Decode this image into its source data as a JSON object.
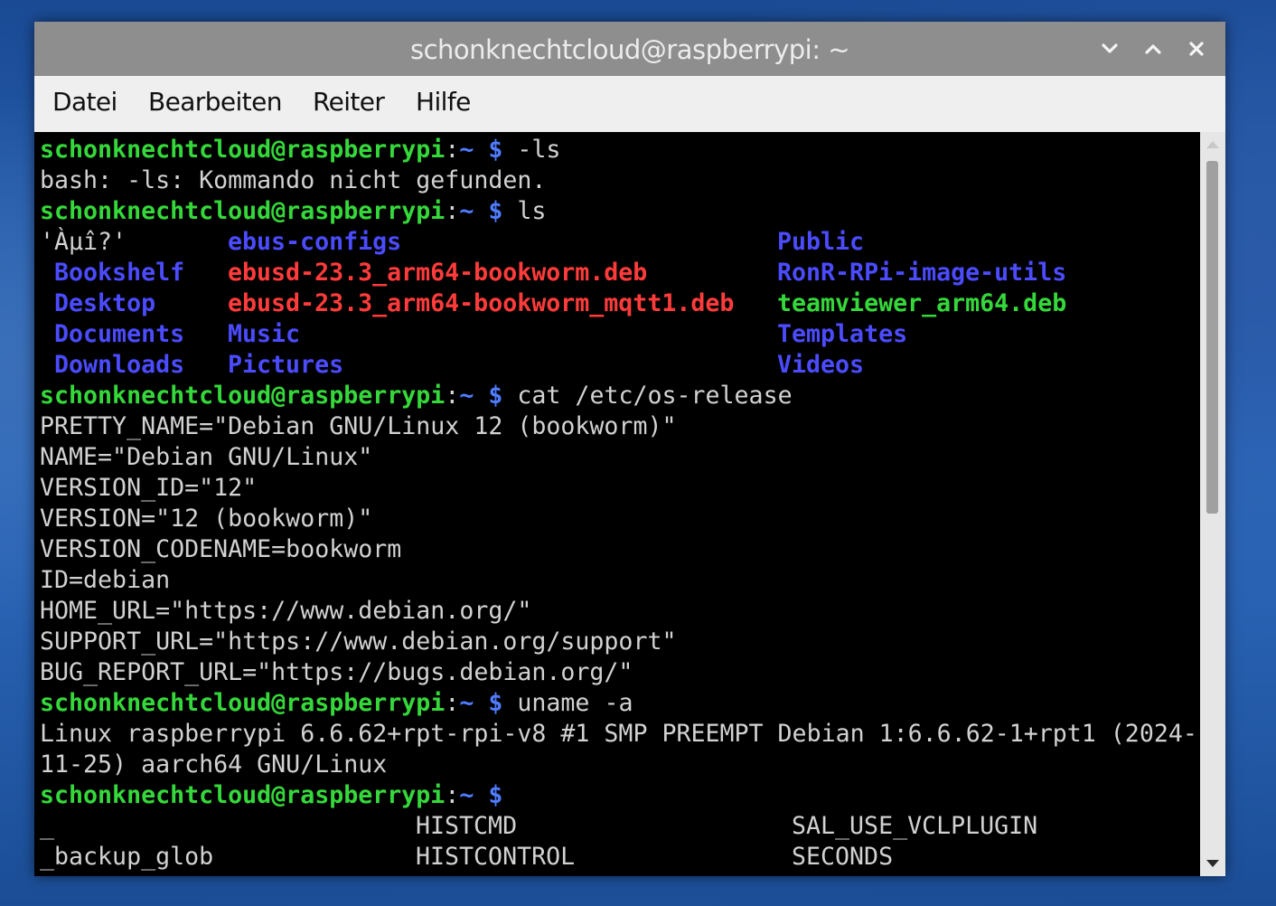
{
  "window": {
    "title": "schonknechtcloud@raspberrypi: ~",
    "buttons": [
      "minimize",
      "maximize",
      "close"
    ]
  },
  "menu": [
    "Datei",
    "Bearbeiten",
    "Reiter",
    "Hilfe"
  ],
  "prompt": {
    "user_host": "schonknechtcloud@raspberrypi",
    "colon": ":",
    "path": "~ $"
  },
  "terminal": {
    "cmd1": " -ls",
    "out1": "bash: -ls: Kommando nicht gefunden.",
    "cmd2": " ls",
    "ls_listing": {
      "col1": [
        "'Àµî?'",
        " Bookshelf",
        " Desktop",
        " Documents",
        " Downloads"
      ],
      "col2": [
        "ebus-configs",
        "ebusd-23.3_arm64-bookworm.deb",
        "ebusd-23.3_arm64-bookworm_mqtt1.deb",
        "Music",
        "Pictures"
      ],
      "col3": [
        "Public",
        "RonR-RPi-image-utils",
        "teamviewer_arm64.deb",
        "Templates",
        "Videos"
      ],
      "kinds": {
        "col1": [
          "plain",
          "dir",
          "dir",
          "dir",
          "dir"
        ],
        "col2": [
          "dir",
          "deb",
          "deb",
          "dir",
          "dir"
        ],
        "col3": [
          "dir",
          "dir",
          "exe",
          "dir",
          "dir"
        ]
      }
    },
    "cmd3": " cat /etc/os-release",
    "os_release": [
      "PRETTY_NAME=\"Debian GNU/Linux 12 (bookworm)\"",
      "NAME=\"Debian GNU/Linux\"",
      "VERSION_ID=\"12\"",
      "VERSION=\"12 (bookworm)\"",
      "VERSION_CODENAME=bookworm",
      "ID=debian",
      "HOME_URL=\"https://www.debian.org/\"",
      "SUPPORT_URL=\"https://www.debian.org/support\"",
      "BUG_REPORT_URL=\"https://bugs.debian.org/\""
    ],
    "cmd4": " uname -a",
    "uname_out": [
      "Linux raspberrypi 6.6.62+rpt-rpi-v8 #1 SMP PREEMPT Debian 1:6.6.62-1+rpt1 (2024-",
      "11-25) aarch64 GNU/Linux"
    ],
    "cmd5": "",
    "completion": [
      [
        "_",
        "HISTCMD",
        "SAL_USE_VCLPLUGIN"
      ],
      [
        "_backup_glob",
        "HISTCONTROL",
        "SECONDS"
      ]
    ]
  },
  "colors": {
    "prompt_user": "#35d83a",
    "prompt_path": "#4f7cff",
    "directory": "#4b4bff",
    "deb_archive": "#ff3b3b",
    "executable": "#35d83a",
    "text": "#d2d2d2"
  }
}
